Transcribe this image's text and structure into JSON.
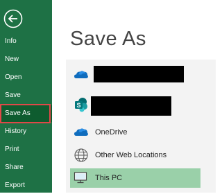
{
  "nav": {
    "back_icon": "back-arrow-icon",
    "items": [
      {
        "label": "Info"
      },
      {
        "label": "New"
      },
      {
        "label": "Open"
      },
      {
        "label": "Save"
      },
      {
        "label": "Save As"
      },
      {
        "label": "History"
      },
      {
        "label": "Print"
      },
      {
        "label": "Share"
      },
      {
        "label": "Export"
      }
    ],
    "selected": "Save As",
    "colors": {
      "background": "#1e7145",
      "selected": "#0e5c2f",
      "highlight_border": "#e04848"
    }
  },
  "main": {
    "title": "Save As",
    "locations": [
      {
        "icon": "onedrive-cloud-icon",
        "label": "",
        "redacted": true
      },
      {
        "icon": "sharepoint-icon",
        "label": "",
        "redacted": true
      },
      {
        "icon": "onedrive-cloud-icon",
        "label": "OneDrive"
      },
      {
        "icon": "globe-icon",
        "label": "Other Web Locations"
      },
      {
        "icon": "computer-icon",
        "label": "This PC",
        "selected": true
      }
    ],
    "colors": {
      "panel": "#f3f3f3",
      "selected_location": "#9ad0a9"
    }
  }
}
